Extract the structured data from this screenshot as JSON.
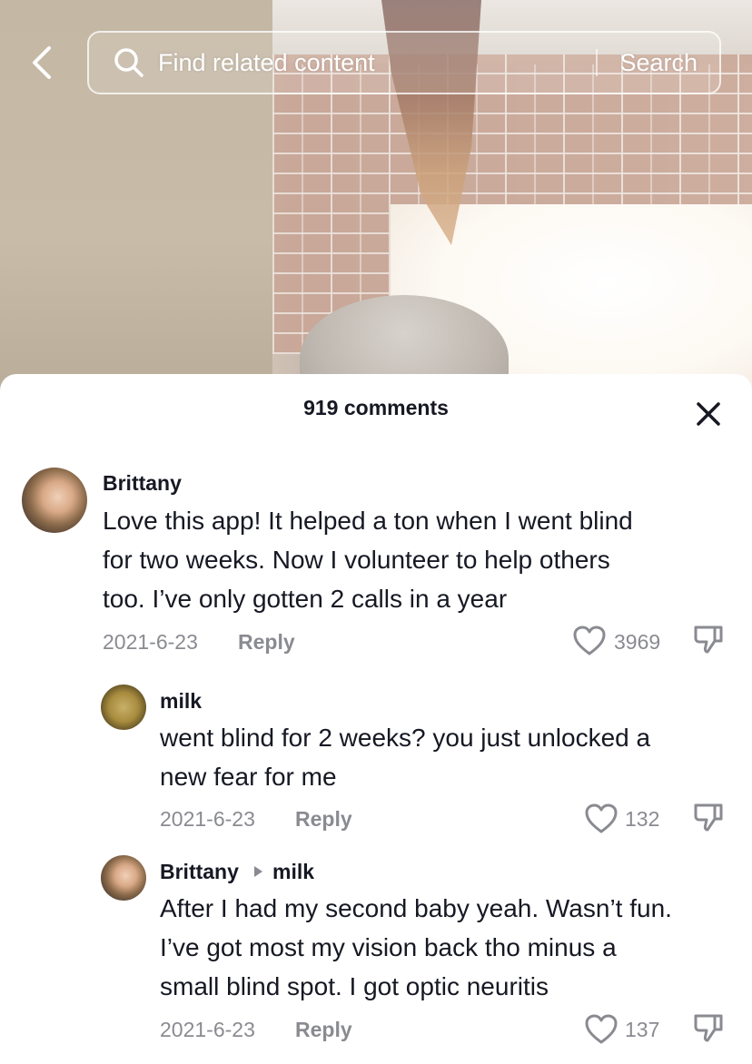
{
  "topbar": {
    "search_placeholder": "Find related content",
    "search_button": "Search"
  },
  "sheet": {
    "title": "919 comments"
  },
  "comments": [
    {
      "user": "Brittany",
      "text_lines": [
        "Love this app! It helped a ton when I went blind",
        "for two weeks. Now I volunteer to help others",
        "too. I’ve only gotten 2 calls in a year"
      ],
      "date": "2021-6-23",
      "reply_label": "Reply",
      "likes": "3969"
    },
    {
      "user": "milk",
      "text_lines": [
        "went blind for 2 weeks? you just unlocked a",
        "new fear for me"
      ],
      "date": "2021-6-23",
      "reply_label": "Reply",
      "likes": "132"
    },
    {
      "user": "Brittany",
      "reply_to": "milk",
      "text_lines": [
        "After I had my second baby yeah. Wasn’t fun.",
        "I’ve got most my vision back tho minus a",
        "small blind spot. I got optic neuritis"
      ],
      "date": "2021-6-23",
      "reply_label": "Reply",
      "likes": "137"
    }
  ],
  "icons": {
    "back": "chevron-left-icon",
    "search": "search-icon",
    "close": "close-icon",
    "like": "heart-icon",
    "dislike": "thumbs-down-icon",
    "reply_arrow": "triangle-right-icon"
  },
  "colors": {
    "text_primary": "#161823",
    "text_secondary": "#8a8b91",
    "sheet_bg": "#ffffff"
  }
}
